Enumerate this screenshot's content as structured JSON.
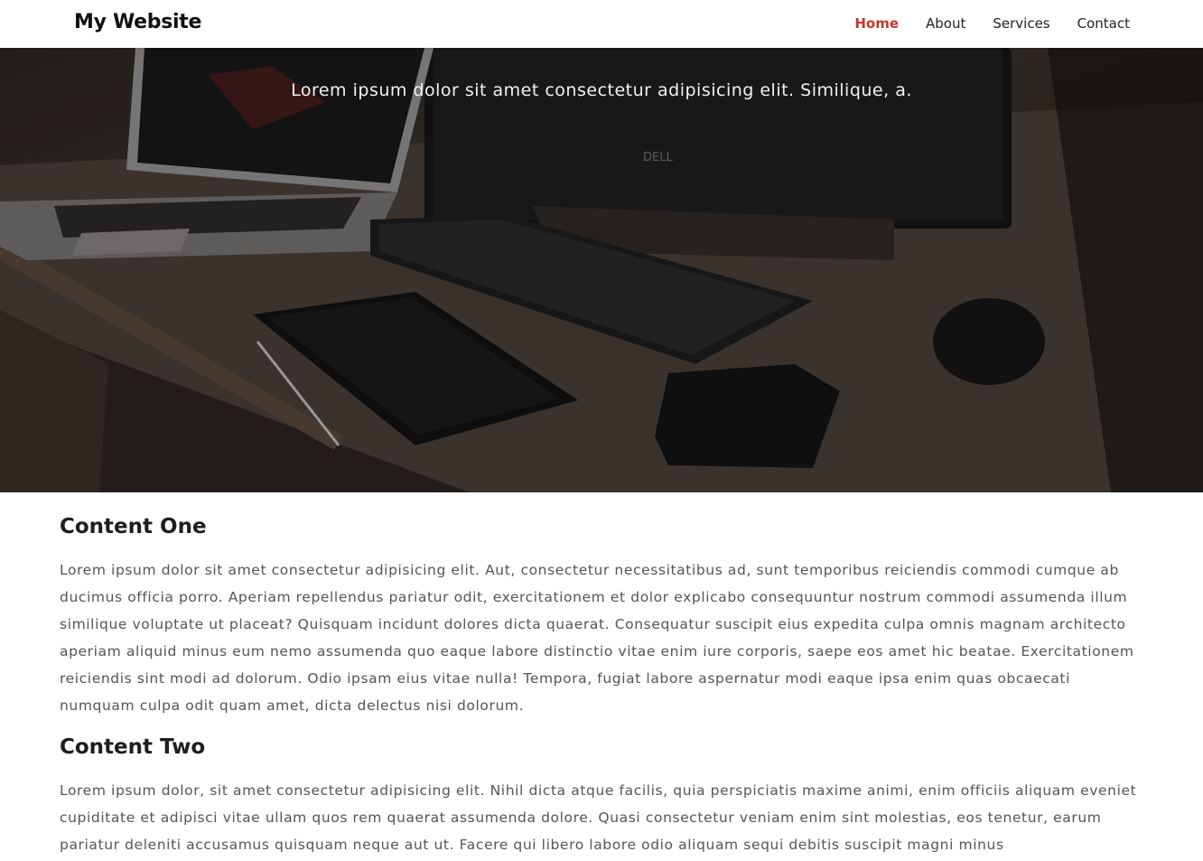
{
  "header": {
    "brand": "My Website",
    "nav": [
      {
        "label": "Home",
        "active": true
      },
      {
        "label": "About",
        "active": false
      },
      {
        "label": "Services",
        "active": false
      },
      {
        "label": "Contact",
        "active": false
      }
    ],
    "active_color": "#c0392b"
  },
  "hero": {
    "subtitle": "Lorem ipsum dolor sit amet consectetur adipisicing elit. Similique, a."
  },
  "sections": [
    {
      "title": "Content One",
      "body": "Lorem ipsum dolor sit amet consectetur adipisicing elit. Aut, consectetur necessitatibus ad, sunt temporibus reiciendis commodi cumque ab ducimus officia porro. Aperiam repellendus pariatur odit, exercitationem et dolor explicabo consequuntur nostrum commodi assumenda illum similique voluptate ut placeat? Quisquam incidunt dolores dicta quaerat. Consequatur suscipit eius expedita culpa omnis magnam architecto aperiam aliquid minus eum nemo assumenda quo eaque labore distinctio vitae enim iure corporis, saepe eos amet hic beatae. Exercitationem reiciendis sint modi ad dolorum. Odio ipsam eius vitae nulla! Tempora, fugiat labore aspernatur modi eaque ipsa enim quas obcaecati numquam culpa odit quam amet, dicta delectus nisi dolorum."
    },
    {
      "title": "Content Two",
      "body": "Lorem ipsum dolor, sit amet consectetur adipisicing elit. Nihil dicta atque facilis, quia perspiciatis maxime animi, enim officiis aliquam eveniet cupiditate et adipisci vitae ullam quos rem quaerat assumenda dolore. Quasi consectetur veniam enim sint molestias, eos tenetur, earum pariatur deleniti accusamus quisquam neque aut ut. Facere qui libero labore odio aliquam sequi debitis suscipit magni minus"
    }
  ]
}
